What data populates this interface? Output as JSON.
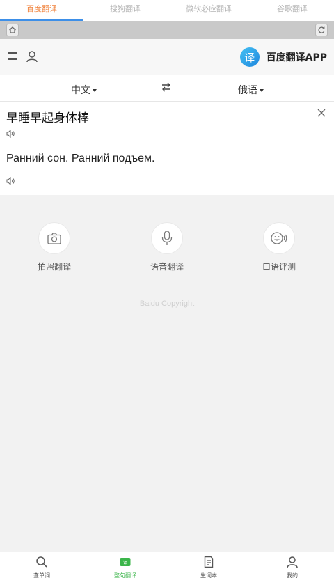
{
  "tabs": [
    {
      "label": "百度翻译",
      "active": true
    },
    {
      "label": "搜狗翻译",
      "active": false
    },
    {
      "label": "微软必应翻译",
      "active": false
    },
    {
      "label": "谷歌翻译",
      "active": false
    }
  ],
  "browser": {
    "home_icon": "home-icon",
    "refresh_icon": "refresh-icon"
  },
  "header": {
    "menu_icon": "menu-icon",
    "user_icon": "user-icon",
    "brand_logo_char": "译",
    "brand_name": "百度翻译APP"
  },
  "languages": {
    "source": "中文",
    "target": "俄语",
    "swap_symbol": "⇄"
  },
  "input": {
    "text": "早睡早起身体棒"
  },
  "output": {
    "text": "Ранний сон. Ранний подъем."
  },
  "tools": [
    {
      "label": "拍照翻译",
      "icon": "camera-icon"
    },
    {
      "label": "语音翻译",
      "icon": "microphone-icon"
    },
    {
      "label": "口语评测",
      "icon": "speaking-icon"
    }
  ],
  "footer": {
    "copyright": "Baidu Copyright"
  },
  "bottom_nav": [
    {
      "label": "查单词",
      "icon": "search-icon",
      "active": false
    },
    {
      "label": "整句翻译",
      "icon": "translate-icon",
      "active": true
    },
    {
      "label": "生词本",
      "icon": "notebook-icon",
      "active": false
    },
    {
      "label": "我的",
      "icon": "person-icon",
      "active": false
    }
  ],
  "colors": {
    "accent_orange": "#f0813a",
    "tab_underline": "#3d8fe8",
    "active_green": "#3bb54a",
    "brand_blue": "#1e87de"
  }
}
